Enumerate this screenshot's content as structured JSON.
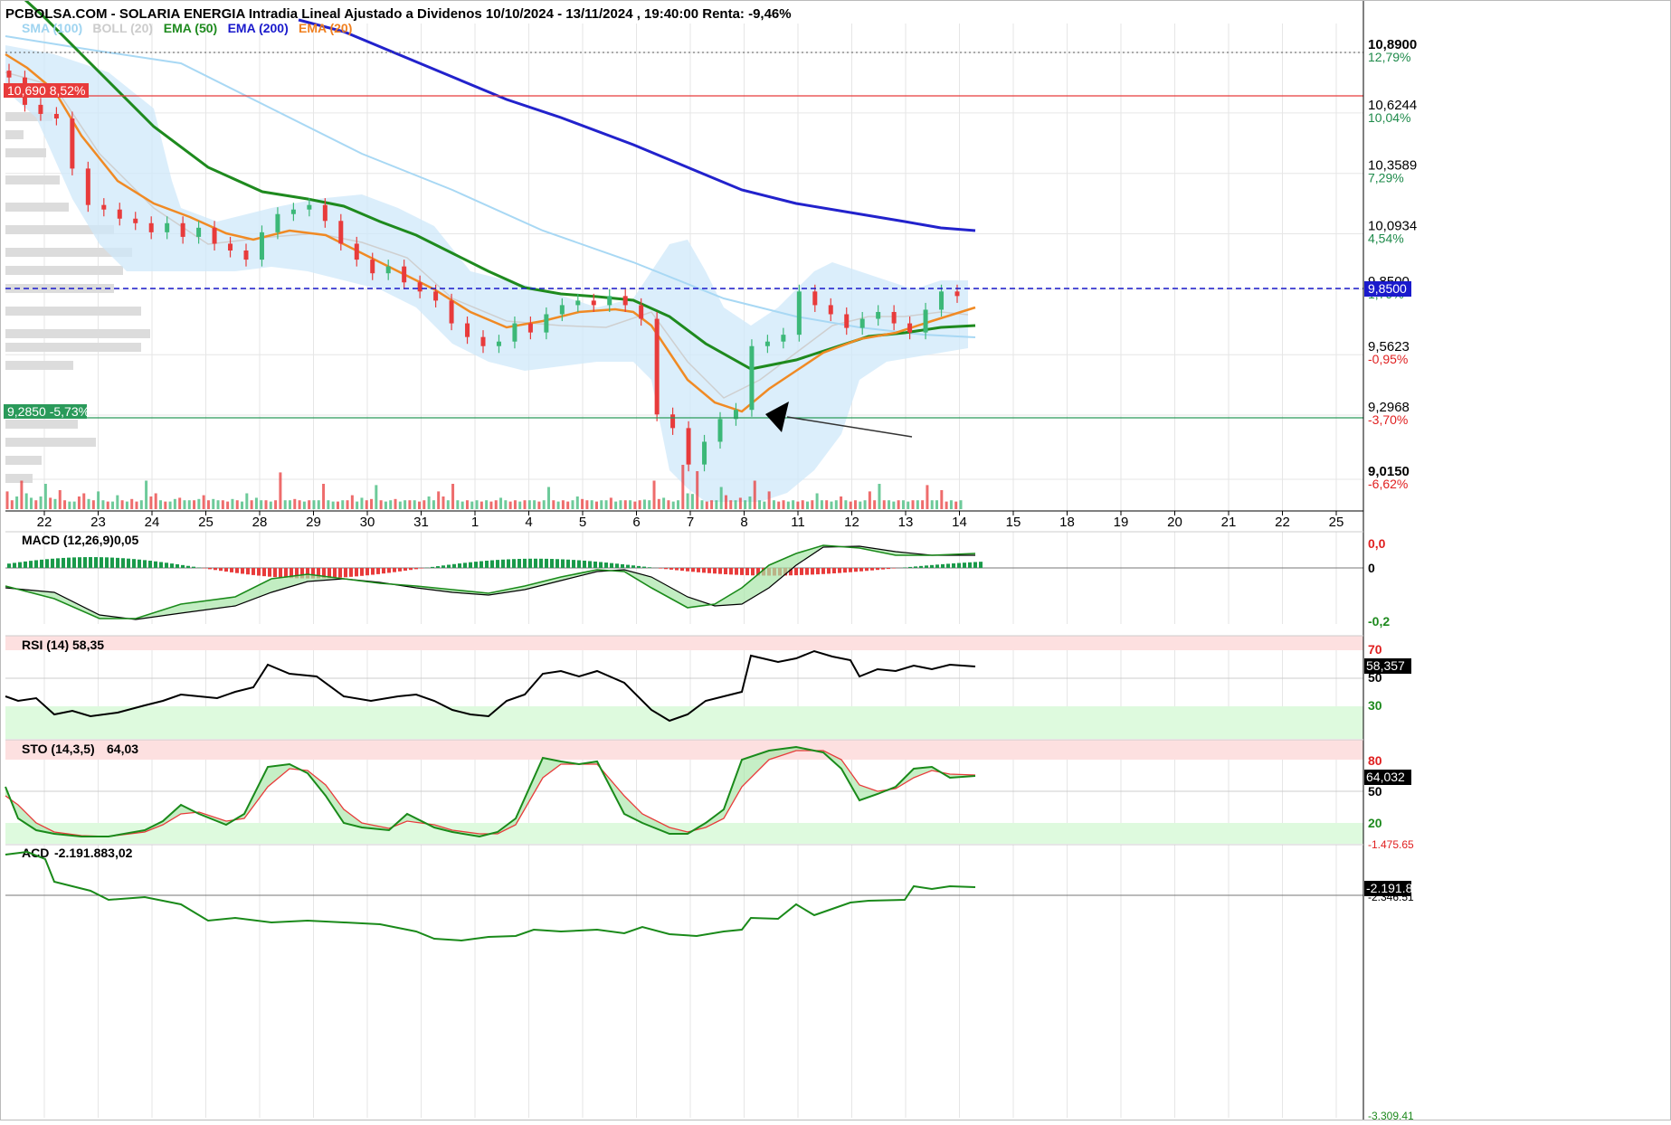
{
  "header": {
    "title": "PCBOLSA.COM - SOLARIA ENERGIA Intradia Lineal Ajustado a Dividenos 10/10/2024 - 13/11/2024 , 19:40:00 Renta: -9,46%"
  },
  "legend": [
    {
      "text": "SMA (100)",
      "color": "#9fd4f0"
    },
    {
      "text": "BOLL (20)",
      "color": "#cccccc"
    },
    {
      "text": "EMA (50)",
      "color": "#1e8a1e"
    },
    {
      "text": "EMA (200)",
      "color": "#1a1acc"
    },
    {
      "text": "EMA (20)",
      "color": "#f08020"
    }
  ],
  "price_axis": [
    {
      "price": "10,8900",
      "pct": "12,79%",
      "sign": "pos"
    },
    {
      "price": "10,6244",
      "pct": "10,04%",
      "sign": "pos"
    },
    {
      "price": "10,3589",
      "pct": "7,29%",
      "sign": "pos"
    },
    {
      "price": "10,0934",
      "pct": "4,54%",
      "sign": "pos"
    },
    {
      "price": "9,8500",
      "pct": "1,79%",
      "sign": "pos"
    },
    {
      "price": "9,5623",
      "pct": "-0,95%",
      "sign": "neg"
    },
    {
      "price": "9,2968",
      "pct": "-3,70%",
      "sign": "neg"
    },
    {
      "price": "9,0150",
      "pct": "-6,62%",
      "sign": "neg"
    }
  ],
  "markers": {
    "upper": {
      "text": "10,690  8,52%",
      "color": "#e83b3b"
    },
    "lower": {
      "text": "9,2850  -5,73%",
      "color": "#2a9a5a"
    },
    "current": {
      "text": "9,8500",
      "color": "#1a1acc"
    }
  },
  "x_axis": [
    "22",
    "23",
    "24",
    "25",
    "28",
    "29",
    "30",
    "31",
    "1",
    "4",
    "5",
    "6",
    "7",
    "8",
    "11",
    "12",
    "13",
    "14",
    "15",
    "18",
    "19",
    "20",
    "21",
    "22",
    "25"
  ],
  "macd": {
    "label": "MACD (12,26,9)",
    "value": "0,05",
    "ticks": [
      "0,0",
      "0",
      "-0,2"
    ]
  },
  "rsi": {
    "label": "RSI (14)",
    "value": "58,35",
    "current": "58,357",
    "ticks": [
      "70",
      "50",
      "30"
    ]
  },
  "sto": {
    "label": "STO (14,3,5)",
    "value": "64,03",
    "current": "64,032",
    "ticks": [
      "80",
      "50",
      "20"
    ]
  },
  "acd": {
    "label": "ACD",
    "value": "-2.191.883,02",
    "current": "-2.191.8",
    "ticks": [
      "-1.475.65",
      "-2.346.51",
      "-3.309.41"
    ]
  },
  "colors": {
    "up": "#3cb878",
    "down": "#e83b3b",
    "boll_fill": "#cfe8fa",
    "ema20": "#f08a24",
    "ema50": "#1e8a1e",
    "ema200": "#2222cc",
    "sma100": "#a8d8f4"
  },
  "chart_data": {
    "type": "candlestick",
    "title": "PCBOLSA.COM - SOLARIA ENERGIA Intradia Lineal Ajustado a Dividenos 10/10/2024 - 13/11/2024 , 19:40:00 Renta: -9,46%",
    "ylim": [
      9.0,
      10.93
    ],
    "days": [
      "22",
      "23",
      "24",
      "25",
      "28",
      "29",
      "30",
      "31",
      "1",
      "4",
      "5",
      "6",
      "7",
      "8",
      "11",
      "12",
      "13",
      "14"
    ],
    "close_path": [
      10.78,
      10.66,
      10.62,
      10.6,
      10.38,
      10.22,
      10.2,
      10.16,
      10.14,
      10.1,
      10.14,
      10.08,
      10.12,
      10.05,
      10.02,
      9.98,
      10.1,
      10.18,
      10.2,
      10.22,
      10.15,
      10.05,
      9.98,
      9.92,
      9.95,
      9.88,
      9.84,
      9.8,
      9.7,
      9.64,
      9.6,
      9.62,
      9.7,
      9.66,
      9.74,
      9.78,
      9.8,
      9.78,
      9.82,
      9.78,
      9.72,
      9.3,
      9.24,
      9.08,
      9.18,
      9.28,
      9.32,
      9.6,
      9.62,
      9.65,
      9.84,
      9.78,
      9.74,
      9.68,
      9.72,
      9.75,
      9.7,
      9.66,
      9.76,
      9.84,
      9.82
    ],
    "ema20": [
      10.88,
      10.72,
      10.6,
      10.48,
      10.35,
      10.26,
      10.2,
      10.15,
      10.12,
      10.08,
      10.06,
      10.05,
      10.03,
      10.0,
      9.98,
      9.96,
      10.0,
      10.04,
      10.05,
      10.04,
      10.02,
      9.98,
      9.92,
      9.86,
      9.8,
      9.74,
      9.7,
      9.66,
      9.64,
      9.66,
      9.7,
      9.72,
      9.73,
      9.74,
      9.72,
      9.6,
      9.45,
      9.34,
      9.28,
      9.3,
      9.38,
      9.48,
      9.56,
      9.62,
      9.66,
      9.7,
      9.72,
      9.74,
      9.76,
      9.78
    ],
    "ema50": [
      11.2,
      10.9,
      10.72,
      10.6,
      10.5,
      10.42,
      10.36,
      10.3,
      10.25,
      10.2,
      10.15,
      10.12,
      10.1,
      10.08,
      10.04,
      10.0,
      9.96,
      9.9,
      9.86,
      9.82,
      9.8,
      9.79,
      9.78,
      9.77,
      9.75,
      9.7,
      9.64,
      9.58,
      9.53,
      9.52,
      9.54,
      9.58,
      9.62,
      9.65,
      9.67,
      9.68,
      9.7,
      9.71,
      9.72
    ],
    "ema200": [
      11.5,
      11.35,
      11.2,
      11.05,
      10.9,
      10.78,
      10.68,
      10.58,
      10.5,
      10.42,
      10.34,
      10.26,
      10.2,
      10.16,
      10.13,
      10.11,
      10.09,
      10.08
    ],
    "indicators": {
      "macd": {
        "last": 0.05
      },
      "rsi": {
        "last": 58.35
      },
      "sto": {
        "last": 64.03
      },
      "acd": {
        "last": -2191883.02
      }
    }
  }
}
